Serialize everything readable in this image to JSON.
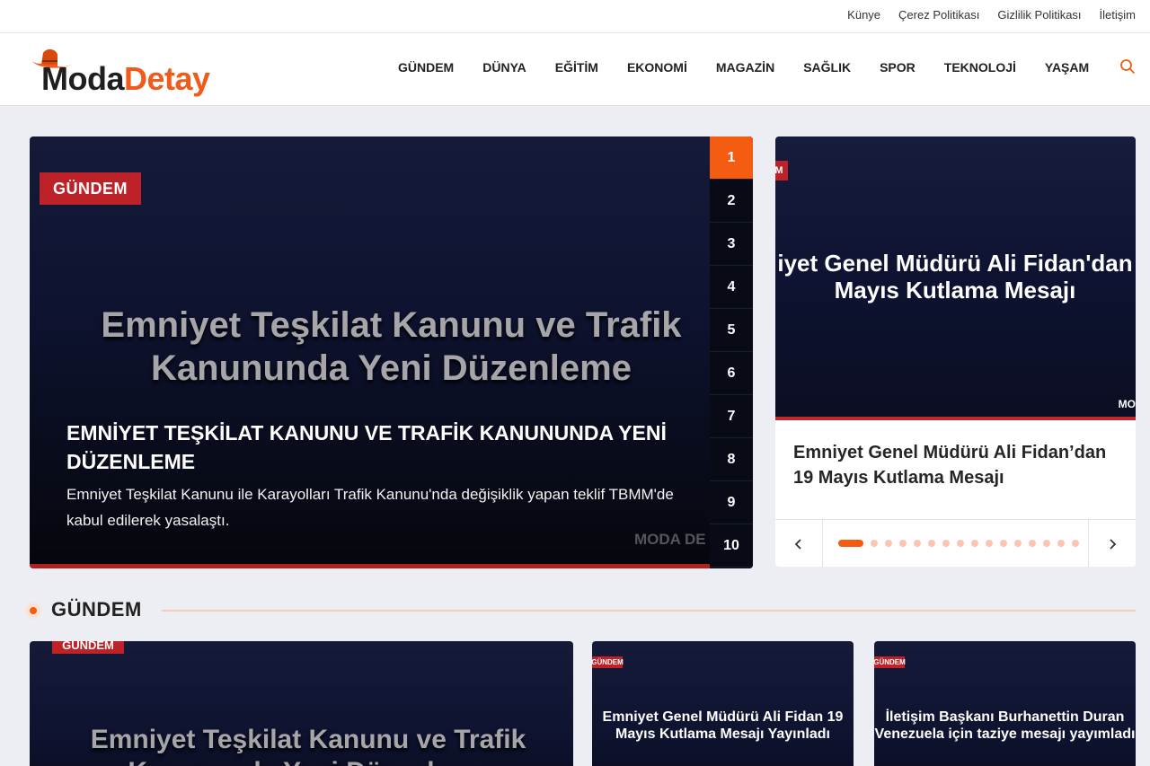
{
  "top_links": [
    "Künye",
    "Çerez Politikası",
    "Gizlilik Politikası",
    "İletişim"
  ],
  "logo": {
    "part1": "Moda",
    "part2": "Detay"
  },
  "nav": [
    "GÜNDEM",
    "DÜNYA",
    "EĞİTİM",
    "EKONOMİ",
    "MAGAZİN",
    "SAĞLIK",
    "SPOR",
    "TEKNOLOJİ",
    "YAŞAM"
  ],
  "slider": {
    "category": "GÜNDEM",
    "image_headline": "Emniyet Teşkilat Kanunu ve Trafik Kanununda Yeni Düzenleme",
    "title": "EMNİYET TEŞKİLAT KANUNU VE TRAFİK KANUNUNDA YENİ DÜZENLEME",
    "description": "Emniyet Teşkilat Kanunu ile Karayolları Trafik Kanunu'nda değişiklik yapan teklif TBMM'de kabul edilerek yasalaştı.",
    "watermark": "MODA DE",
    "pages": [
      "1",
      "2",
      "3",
      "4",
      "5",
      "6",
      "7",
      "8",
      "9",
      "10"
    ],
    "active_page": 1
  },
  "side_slider": {
    "badge": "M",
    "image_headline_line1": "iyet Genel Müdürü Ali Fidan'dan",
    "image_headline_line2": "Mayıs Kutlama Mesajı",
    "image_corner": "MO",
    "title": "Emniyet Genel Müdürü Ali Fidan’dan 19 Mayıs Kutlama Mesajı",
    "dot_count": 16,
    "active_dot": 1
  },
  "section": {
    "title": "GÜNDEM"
  },
  "cards": [
    {
      "badge": "GÜNDEM",
      "headline": "Emniyet Teşkilat Kanunu ve Trafik Kanununda Yeni Düzenleme"
    },
    {
      "badge": "GÜNDEM",
      "headline_line1": "Emniyet Genel Müdürü Ali Fidan 19",
      "headline_line2": "Mayıs Kutlama Mesajı Yayınladı"
    },
    {
      "badge": "GÜNDEM",
      "headline_line1": "İletişim Başkanı Burhanettin Duran",
      "headline_line2": "Venezuela için taziye mesajı yayımladı"
    }
  ],
  "colors": {
    "accent": "#f45c12",
    "badge_red": "#bd2228",
    "dark_bg": "#0e1330"
  }
}
